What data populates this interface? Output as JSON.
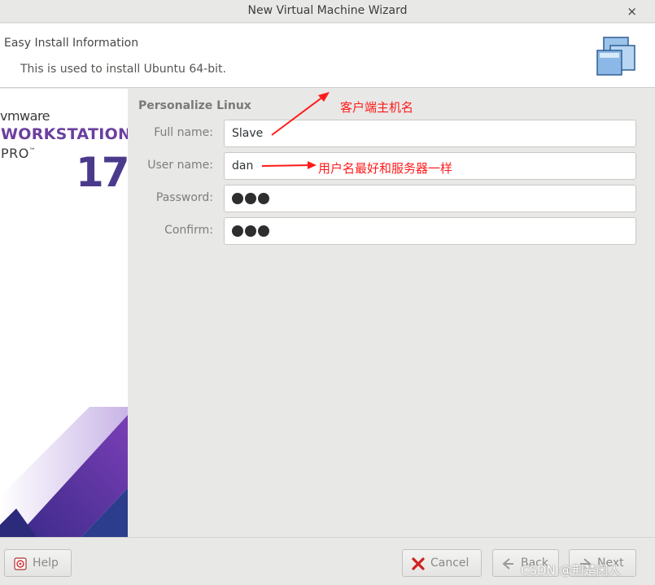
{
  "window": {
    "title": "New Virtual Machine Wizard",
    "close_glyph": "×"
  },
  "header": {
    "title": "Easy Install Information",
    "subtitle": "This is used to install Ubuntu 64-bit.",
    "icon": "virtual-machines-icon"
  },
  "sidebar": {
    "brand_vendor": "vmware",
    "brand_product": "WORKSTATION",
    "brand_edition": "PRO",
    "brand_tm": "™",
    "brand_version": "17"
  },
  "form": {
    "section_title": "Personalize Linux",
    "fields": [
      {
        "label": "Full name:",
        "value": "Slave"
      },
      {
        "label": "User name:",
        "value": "dan"
      },
      {
        "label": "Password:",
        "masked_length": 3
      },
      {
        "label": "Confirm:",
        "masked_length": 3
      }
    ]
  },
  "annotations": {
    "full_name_note": "客户端主机名",
    "user_name_note": "用户名最好和服务器一样",
    "color": "#ff1a1a"
  },
  "buttons": {
    "help": "Help",
    "cancel": "Cancel",
    "back": "Back",
    "next": "Next"
  },
  "watermark": "CSDN @荆楚闲人",
  "colors": {
    "brand_purple": "#6b3fa0",
    "version_purple": "#4b3a8c"
  }
}
